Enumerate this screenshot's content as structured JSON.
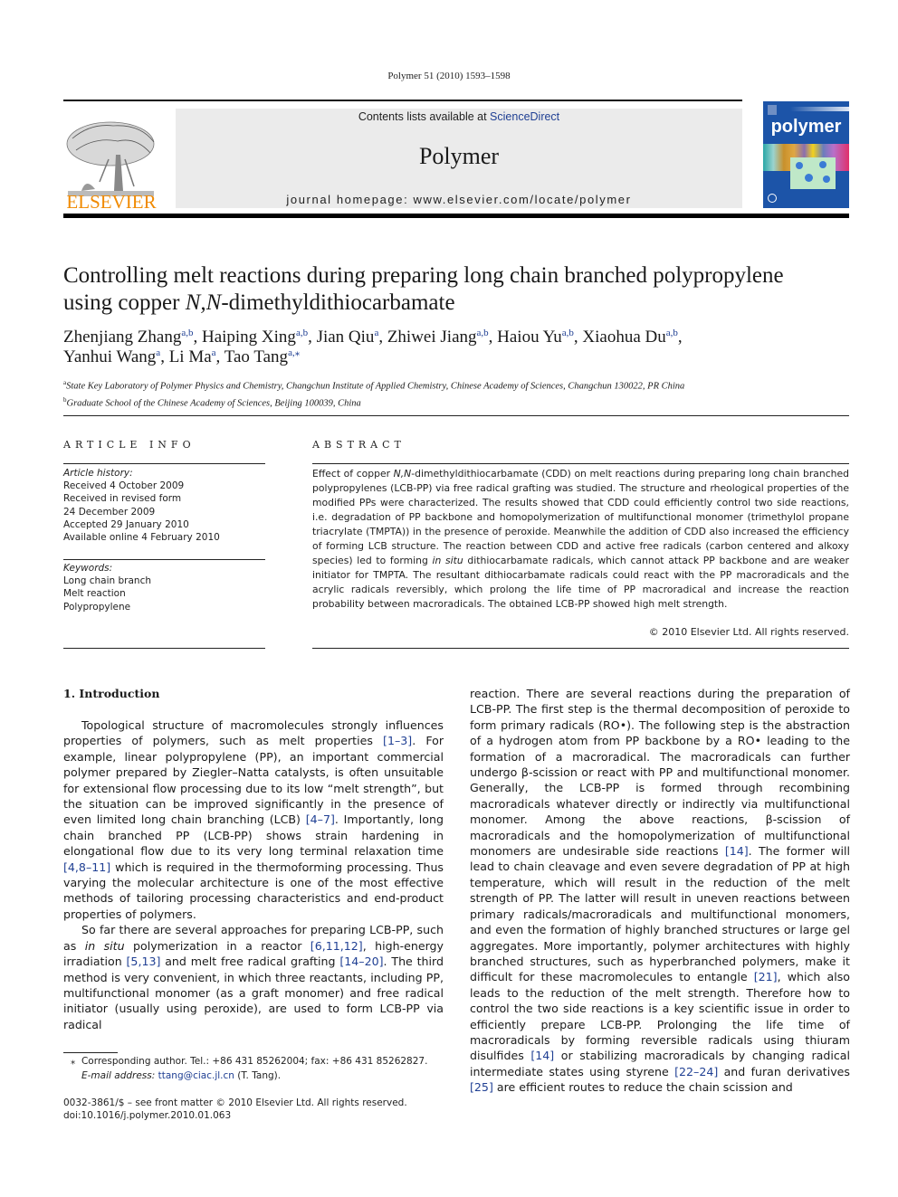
{
  "running_head": "Polymer 51 (2010) 1593–1598",
  "masthead": {
    "publisher_logo_text": "ELSEVIER",
    "contents_prefix": "Contents lists available at ",
    "contents_link": "ScienceDirect",
    "journal_name": "Polymer",
    "homepage": "journal homepage: www.elsevier.com/locate/polymer",
    "cover_title": "polymer",
    "colors": {
      "elsevier_orange": "#f08a00",
      "cover_blue": "#1c54a8",
      "link_blue": "#1f3f93",
      "banner_gray": "#ebebeb"
    }
  },
  "article": {
    "title_line1": "Controlling melt reactions during preparing long chain branched polypropylene",
    "title_line2_prefix": "using copper ",
    "title_line2_italic": "N,N",
    "title_line2_suffix": "-dimethyldithiocarbamate",
    "authors": [
      {
        "name": "Zhenjiang Zhang",
        "aff": "a,b",
        "sep": ", "
      },
      {
        "name": "Haiping Xing",
        "aff": "a,b",
        "sep": ", "
      },
      {
        "name": "Jian Qiu",
        "aff": "a",
        "sep": ", "
      },
      {
        "name": "Zhiwei Jiang",
        "aff": "a,b",
        "sep": ", "
      },
      {
        "name": "Haiou Yu",
        "aff": "a,b",
        "sep": ", "
      },
      {
        "name": "Xiaohua Du",
        "aff": "a,b",
        "sep": ","
      },
      {
        "name": "Yanhui Wang",
        "aff": "a",
        "sep": ", "
      },
      {
        "name": "Li Ma",
        "aff": "a",
        "sep": ", "
      },
      {
        "name": "Tao Tang",
        "aff": "a,⁎",
        "sep": ""
      }
    ],
    "affiliations": [
      {
        "mark": "a",
        "text": "State Key Laboratory of Polymer Physics and Chemistry, Changchun Institute of Applied Chemistry, Chinese Academy of Sciences, Changchun 130022, PR China"
      },
      {
        "mark": "b",
        "text": "Graduate School of the Chinese Academy of Sciences, Beijing 100039, China"
      }
    ]
  },
  "article_info": {
    "label": "ARTICLE INFO",
    "history_heading": "Article history:",
    "history": [
      "Received 4 October 2009",
      "Received in revised form",
      "24 December 2009",
      "Accepted 29 January 2010",
      "Available online 4 February 2010"
    ],
    "keywords_heading": "Keywords:",
    "keywords": [
      "Long chain branch",
      "Melt reaction",
      "Polypropylene"
    ]
  },
  "abstract": {
    "label": "ABSTRACT",
    "part1": "Effect of copper ",
    "italic1": "N,N",
    "part2": "-dimethyldithiocarbamate (CDD) on melt reactions during preparing long chain branched polypropylenes (LCB-PP) via free radical grafting was studied. The structure and rheological properties of the modified PPs were characterized. The results showed that CDD could efficiently control two side reactions, i.e. degradation of PP backbone and homopolymerization of multifunctional monomer (trimethylol propane triacrylate (TMPTA)) in the presence of peroxide. Meanwhile the addition of CDD also increased the efficiency of forming LCB structure. The reaction between CDD and active free radicals (carbon centered and alkoxy species) led to forming ",
    "italic2": "in situ",
    "part3": " dithiocarbamate radicals, which cannot attack PP backbone and are weaker initiator for TMPTA. The resultant dithiocarbamate radicals could react with the PP macroradicals and the acrylic radicals reversibly, which prolong the life time of PP macroradical and increase the reaction probability between macroradicals. The obtained LCB-PP showed high melt strength.",
    "copyright": "© 2010 Elsevier Ltd. All rights reserved."
  },
  "introduction": {
    "heading": "1.  Introduction",
    "p1": [
      {
        "t": "Topological structure of macromolecules strongly influences properties of polymers, such as melt properties "
      },
      {
        "ref": "[1–3]"
      },
      {
        "t": ". For example, linear polypropylene (PP), an important commercial polymer prepared by Ziegler–Natta catalysts, is often unsuitable for extensional flow processing due to its low “melt strength”, but the situation can be improved significantly in the presence of even limited long chain branching (LCB) "
      },
      {
        "ref": "[4–7]"
      },
      {
        "t": ". Importantly, long chain branched PP (LCB-PP) shows strain hardening in elongational flow due to its very long terminal relaxation time "
      },
      {
        "ref": "[4,8–11]"
      },
      {
        "t": " which is required in the thermoforming processing. Thus varying the molecular architecture is one of the most effective methods of tailoring processing characteristics and end-product properties of polymers."
      }
    ],
    "p2": [
      {
        "t": "So far there are several approaches for preparing LCB-PP, such as "
      },
      {
        "i": "in situ"
      },
      {
        "t": " polymerization in a reactor "
      },
      {
        "ref": "[6,11,12]"
      },
      {
        "t": ", high-energy irradiation "
      },
      {
        "ref": "[5,13]"
      },
      {
        "t": " and melt free radical grafting "
      },
      {
        "ref": "[14–20]"
      },
      {
        "t": ". The third method is very convenient, in which three reactants, including PP, multifunctional monomer (as a graft monomer) and free radical initiator (usually using peroxide), are used to form LCB-PP via radical"
      }
    ],
    "p3": [
      {
        "t": "reaction. There are several reactions during the preparation of LCB-PP. The first step is the thermal decomposition of peroxide to form primary radicals (RO•). The following step is the abstraction of a hydrogen atom from PP backbone by a RO• leading to the formation of a macroradical. The macroradicals can further undergo β-scission or react with PP and multifunctional monomer. Generally, the LCB-PP is formed through recombining macroradicals whatever directly or indirectly via multifunctional monomer. Among the above reactions, β-scission of macroradicals and the homopolymerization of multifunctional monomers are undesirable side reactions "
      },
      {
        "ref": "[14]"
      },
      {
        "t": ". The former will lead to chain cleavage and even severe degradation of PP at high temperature, which will result in the reduction of the melt strength of PP. The latter will result in uneven reactions between primary radicals/macroradicals and multifunctional monomers, and even the formation of highly branched structures or large gel aggregates. More importantly, polymer architectures with highly branched structures, such as hyperbranched polymers, make it difficult for these macromolecules to entangle "
      },
      {
        "ref": "[21]"
      },
      {
        "t": ", which also leads to the reduction of the melt strength. Therefore how to control the two side reactions is a key scientific issue in order to efficiently prepare LCB-PP. Prolonging the life time of macroradicals by forming reversible radicals using thiuram disulfides "
      },
      {
        "ref": "[14]"
      },
      {
        "t": " or stabilizing macroradicals by changing radical intermediate states using styrene "
      },
      {
        "ref": "[22–24]"
      },
      {
        "t": " and furan derivatives "
      },
      {
        "ref": "[25]"
      },
      {
        "t": " are efficient routes to reduce the chain scission and"
      }
    ]
  },
  "footnote": {
    "mark": "⁎",
    "corresponding": "Corresponding author. Tel.: +86 431 85262004; fax: +86 431 85262827.",
    "email_label": "E-mail address: ",
    "email": "ttang@ciac.jl.cn",
    "email_suffix": " (T. Tang)."
  },
  "issn_line": "0032-3861/$ – see front matter © 2010 Elsevier Ltd. All rights reserved.",
  "doi_line": "doi:10.1016/j.polymer.2010.01.063"
}
